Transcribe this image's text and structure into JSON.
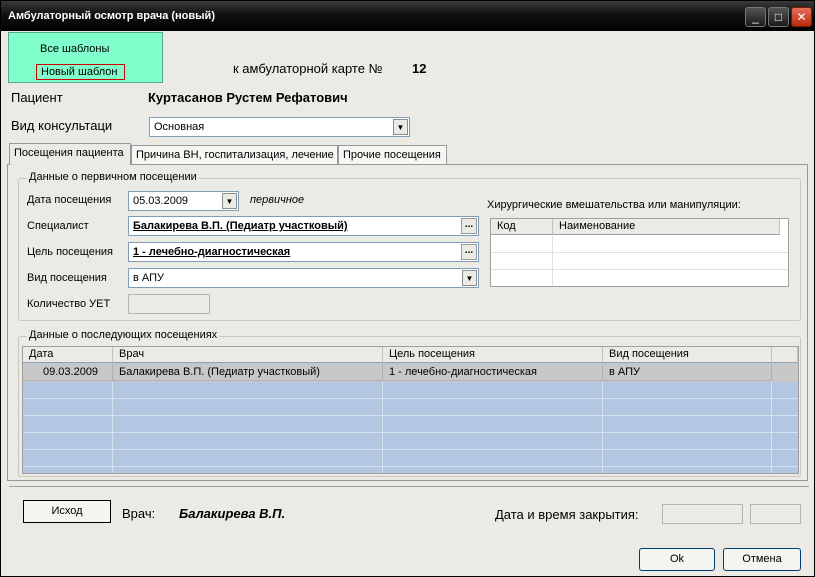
{
  "window": {
    "title": "Амбулаторный осмотр врача (новый)",
    "minimize_glyph": "_",
    "maximize_glyph": "□",
    "close_glyph": "✕"
  },
  "template_menu": {
    "items": [
      "Все шаблоны",
      "Новый шаблон"
    ]
  },
  "card": {
    "label": "к амбулаторной карте №",
    "number": "12"
  },
  "patient": {
    "label": "Пациент",
    "name": "Куртасанов Рустем Рефатович"
  },
  "consultation": {
    "label": "Вид консультаци",
    "value": "Основная"
  },
  "tabs": [
    {
      "label": "Посещения пациента",
      "active": true
    },
    {
      "label": "Причина ВН, госпитализация, лечение",
      "active": false
    },
    {
      "label": "Прочие посещения",
      "active": false
    }
  ],
  "primary": {
    "group_title": "Данные о первичном посещении",
    "visit_date_label": "Дата посещения",
    "visit_date": "05.03.2009",
    "visit_kind_note": "первичное",
    "specialist_label": "Специалист",
    "specialist": "Балакирева В.П. (Педиатр участковый)",
    "purpose_label": "Цель посещения",
    "purpose": "1 - лечебно-диагностическая",
    "visit_type_label": "Вид посещения",
    "visit_type": "в АПУ",
    "uet_label": "Количество УЕТ",
    "uet": ""
  },
  "surgery": {
    "title": "Хирургические вмешательства или манипуляции:",
    "columns": [
      "Код",
      "Наименование"
    ]
  },
  "subsequent": {
    "group_title": "Данные о последующих посещениях",
    "columns": [
      "Дата",
      "Врач",
      "Цель посещения",
      "Вид посещения"
    ],
    "rows": [
      [
        "09.03.2009",
        "Балакирева В.П. (Педиатр участковый)",
        "1 - лечебно-диагностическая",
        "в АПУ"
      ]
    ]
  },
  "footer": {
    "outcome_button": "Исход",
    "doctor_label": "Врач:",
    "doctor_name": "Балакирева В.П.",
    "closing_label": "Дата и время закрытия:",
    "ok": "Ok",
    "cancel": "Отмена"
  },
  "colors": {
    "grid_row": "#b3c6e2",
    "popup": "#80ffcc"
  }
}
